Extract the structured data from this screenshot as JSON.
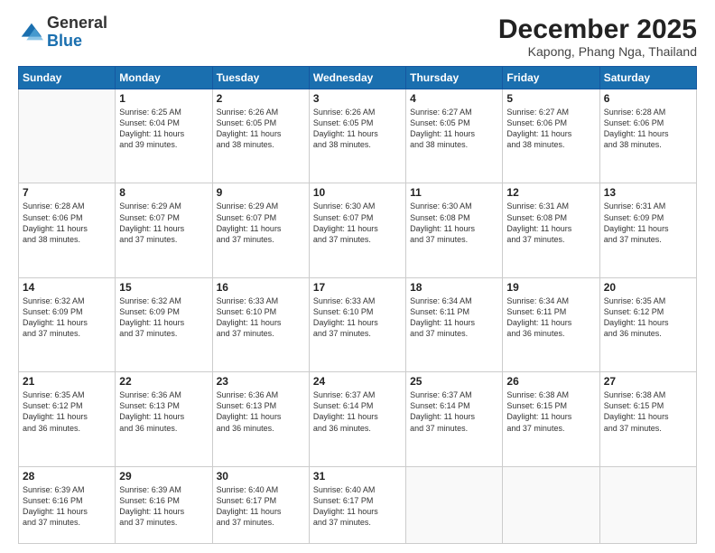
{
  "header": {
    "logo_general": "General",
    "logo_blue": "Blue",
    "month": "December 2025",
    "location": "Kapong, Phang Nga, Thailand"
  },
  "weekdays": [
    "Sunday",
    "Monday",
    "Tuesday",
    "Wednesday",
    "Thursday",
    "Friday",
    "Saturday"
  ],
  "weeks": [
    [
      {
        "day": "",
        "info": ""
      },
      {
        "day": "1",
        "info": "Sunrise: 6:25 AM\nSunset: 6:04 PM\nDaylight: 11 hours\nand 39 minutes."
      },
      {
        "day": "2",
        "info": "Sunrise: 6:26 AM\nSunset: 6:05 PM\nDaylight: 11 hours\nand 38 minutes."
      },
      {
        "day": "3",
        "info": "Sunrise: 6:26 AM\nSunset: 6:05 PM\nDaylight: 11 hours\nand 38 minutes."
      },
      {
        "day": "4",
        "info": "Sunrise: 6:27 AM\nSunset: 6:05 PM\nDaylight: 11 hours\nand 38 minutes."
      },
      {
        "day": "5",
        "info": "Sunrise: 6:27 AM\nSunset: 6:06 PM\nDaylight: 11 hours\nand 38 minutes."
      },
      {
        "day": "6",
        "info": "Sunrise: 6:28 AM\nSunset: 6:06 PM\nDaylight: 11 hours\nand 38 minutes."
      }
    ],
    [
      {
        "day": "7",
        "info": "Sunrise: 6:28 AM\nSunset: 6:06 PM\nDaylight: 11 hours\nand 38 minutes."
      },
      {
        "day": "8",
        "info": "Sunrise: 6:29 AM\nSunset: 6:07 PM\nDaylight: 11 hours\nand 37 minutes."
      },
      {
        "day": "9",
        "info": "Sunrise: 6:29 AM\nSunset: 6:07 PM\nDaylight: 11 hours\nand 37 minutes."
      },
      {
        "day": "10",
        "info": "Sunrise: 6:30 AM\nSunset: 6:07 PM\nDaylight: 11 hours\nand 37 minutes."
      },
      {
        "day": "11",
        "info": "Sunrise: 6:30 AM\nSunset: 6:08 PM\nDaylight: 11 hours\nand 37 minutes."
      },
      {
        "day": "12",
        "info": "Sunrise: 6:31 AM\nSunset: 6:08 PM\nDaylight: 11 hours\nand 37 minutes."
      },
      {
        "day": "13",
        "info": "Sunrise: 6:31 AM\nSunset: 6:09 PM\nDaylight: 11 hours\nand 37 minutes."
      }
    ],
    [
      {
        "day": "14",
        "info": "Sunrise: 6:32 AM\nSunset: 6:09 PM\nDaylight: 11 hours\nand 37 minutes."
      },
      {
        "day": "15",
        "info": "Sunrise: 6:32 AM\nSunset: 6:09 PM\nDaylight: 11 hours\nand 37 minutes."
      },
      {
        "day": "16",
        "info": "Sunrise: 6:33 AM\nSunset: 6:10 PM\nDaylight: 11 hours\nand 37 minutes."
      },
      {
        "day": "17",
        "info": "Sunrise: 6:33 AM\nSunset: 6:10 PM\nDaylight: 11 hours\nand 37 minutes."
      },
      {
        "day": "18",
        "info": "Sunrise: 6:34 AM\nSunset: 6:11 PM\nDaylight: 11 hours\nand 37 minutes."
      },
      {
        "day": "19",
        "info": "Sunrise: 6:34 AM\nSunset: 6:11 PM\nDaylight: 11 hours\nand 36 minutes."
      },
      {
        "day": "20",
        "info": "Sunrise: 6:35 AM\nSunset: 6:12 PM\nDaylight: 11 hours\nand 36 minutes."
      }
    ],
    [
      {
        "day": "21",
        "info": "Sunrise: 6:35 AM\nSunset: 6:12 PM\nDaylight: 11 hours\nand 36 minutes."
      },
      {
        "day": "22",
        "info": "Sunrise: 6:36 AM\nSunset: 6:13 PM\nDaylight: 11 hours\nand 36 minutes."
      },
      {
        "day": "23",
        "info": "Sunrise: 6:36 AM\nSunset: 6:13 PM\nDaylight: 11 hours\nand 36 minutes."
      },
      {
        "day": "24",
        "info": "Sunrise: 6:37 AM\nSunset: 6:14 PM\nDaylight: 11 hours\nand 36 minutes."
      },
      {
        "day": "25",
        "info": "Sunrise: 6:37 AM\nSunset: 6:14 PM\nDaylight: 11 hours\nand 37 minutes."
      },
      {
        "day": "26",
        "info": "Sunrise: 6:38 AM\nSunset: 6:15 PM\nDaylight: 11 hours\nand 37 minutes."
      },
      {
        "day": "27",
        "info": "Sunrise: 6:38 AM\nSunset: 6:15 PM\nDaylight: 11 hours\nand 37 minutes."
      }
    ],
    [
      {
        "day": "28",
        "info": "Sunrise: 6:39 AM\nSunset: 6:16 PM\nDaylight: 11 hours\nand 37 minutes."
      },
      {
        "day": "29",
        "info": "Sunrise: 6:39 AM\nSunset: 6:16 PM\nDaylight: 11 hours\nand 37 minutes."
      },
      {
        "day": "30",
        "info": "Sunrise: 6:40 AM\nSunset: 6:17 PM\nDaylight: 11 hours\nand 37 minutes."
      },
      {
        "day": "31",
        "info": "Sunrise: 6:40 AM\nSunset: 6:17 PM\nDaylight: 11 hours\nand 37 minutes."
      },
      {
        "day": "",
        "info": ""
      },
      {
        "day": "",
        "info": ""
      },
      {
        "day": "",
        "info": ""
      }
    ]
  ]
}
